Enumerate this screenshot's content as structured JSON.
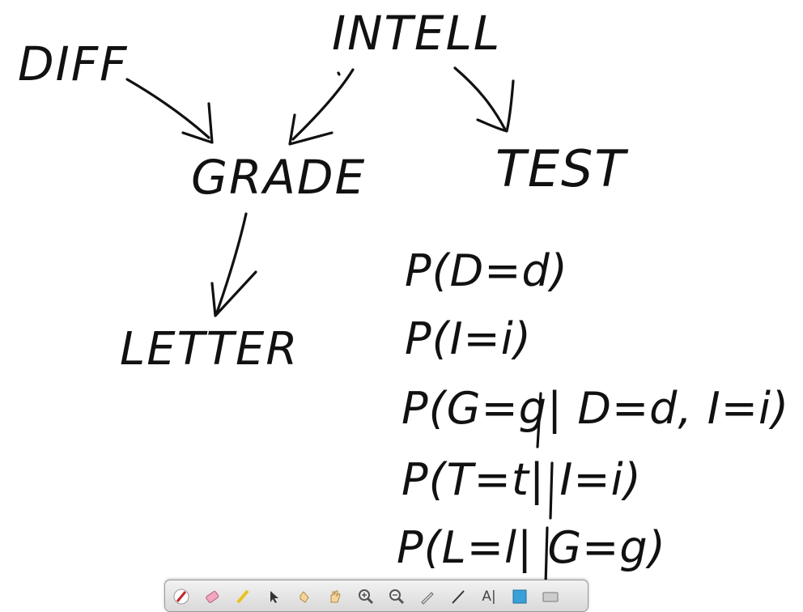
{
  "nodes": {
    "diff": "DIFF",
    "intell": "INTELL",
    "grade": "GRADE",
    "test": "TEST",
    "letter": "LETTER"
  },
  "formulas": [
    "P(D=d)",
    "P(I=i)",
    "P(G=g| D=d, I=i)",
    "P(T=t| I=i)",
    "P(L=l| G=g)"
  ],
  "edges": [
    {
      "from": "diff",
      "to": "grade"
    },
    {
      "from": "intell",
      "to": "grade"
    },
    {
      "from": "intell",
      "to": "test"
    },
    {
      "from": "grade",
      "to": "letter"
    }
  ],
  "toolbar": {
    "tools": [
      {
        "icon": "pen-icon"
      },
      {
        "icon": "eraser-icon"
      },
      {
        "icon": "highlighter-icon"
      },
      {
        "icon": "pointer-icon"
      },
      {
        "icon": "laser-hand-icon"
      },
      {
        "icon": "pan-hand-icon"
      },
      {
        "icon": "zoom-in-icon"
      },
      {
        "icon": "zoom-out-icon"
      },
      {
        "icon": "marker-icon"
      },
      {
        "icon": "line-icon"
      },
      {
        "icon": "text-icon"
      },
      {
        "icon": "color-swatch-icon"
      },
      {
        "icon": "keyboard-icon"
      }
    ],
    "text_tool_glyph": "A|",
    "swatch_color": "#3aa0d8",
    "ink_color": "#111111"
  }
}
